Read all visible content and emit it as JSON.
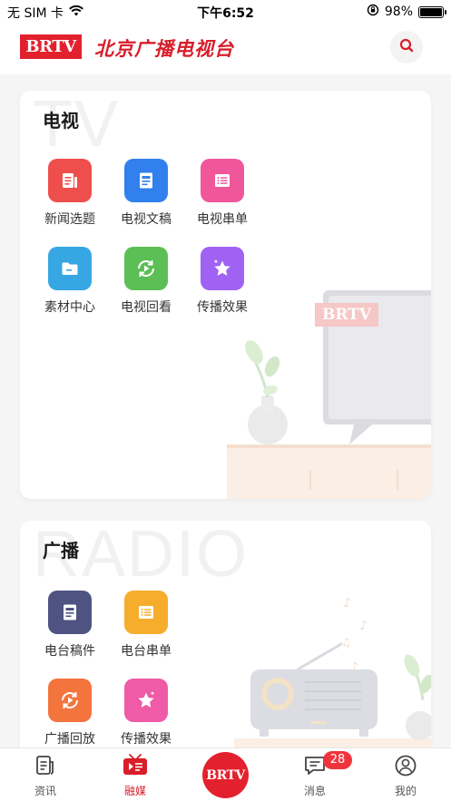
{
  "status_bar": {
    "carrier": "无 SIM 卡",
    "time": "下午6:52",
    "battery_percent": "98%",
    "battery_level": 0.98
  },
  "header": {
    "logo_text": "BRTV",
    "brand_name": "北京广播电视台",
    "search_icon": "search-icon"
  },
  "tv_section": {
    "watermark": "TV",
    "title": "电视",
    "items": [
      {
        "label": "新闻选题",
        "icon": "news-topic-icon",
        "color": "#ee4e4c"
      },
      {
        "label": "电视文稿",
        "icon": "document-icon",
        "color": "#3180ee"
      },
      {
        "label": "电视串单",
        "icon": "list-icon",
        "color": "#f0579b"
      },
      {
        "label": "素材中心",
        "icon": "folder-icon",
        "color": "#36a7e2"
      },
      {
        "label": "电视回看",
        "icon": "replay-icon",
        "color": "#5cbf56"
      },
      {
        "label": "传播效果",
        "icon": "star-icon",
        "color": "#9f62f3"
      }
    ],
    "tv_screen_logo": "BRTV"
  },
  "radio_section": {
    "watermark": "RADIO",
    "title": "广播",
    "items": [
      {
        "label": "电台稿件",
        "icon": "manuscript-icon",
        "color": "#4e5382"
      },
      {
        "label": "电台串单",
        "icon": "list-icon",
        "color": "#f6ad2b"
      },
      {
        "label": "广播回放",
        "icon": "replay-icon",
        "color": "#f4743e"
      },
      {
        "label": "传播效果",
        "icon": "star-icon",
        "color": "#ef5ba6"
      }
    ]
  },
  "tab_bar": {
    "tabs": [
      {
        "label": "资讯",
        "icon": "news-icon",
        "active": false
      },
      {
        "label": "融媒",
        "icon": "media-icon",
        "active": true
      },
      {
        "label": "BRTV",
        "icon": "brtv-center-icon",
        "active": false
      },
      {
        "label": "消息",
        "icon": "message-icon",
        "active": false
      },
      {
        "label": "我的",
        "icon": "profile-icon",
        "active": false
      }
    ],
    "message_badge": "28"
  },
  "colors": {
    "brand_red": "#e3212e",
    "accent_red": "#d81e2b"
  }
}
